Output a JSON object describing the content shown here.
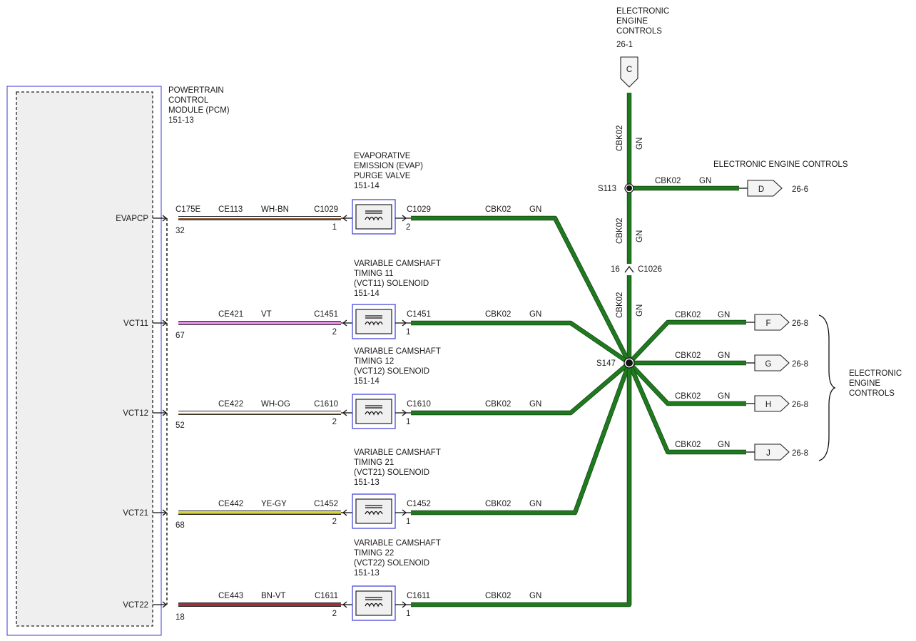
{
  "pcm": {
    "title_lines": [
      "POWERTRAIN",
      "CONTROL",
      "MODULE (PCM)",
      "151-13"
    ],
    "connector": "C175E"
  },
  "circuits": [
    {
      "pin_label": "EVAPCP",
      "pin": "32",
      "circuit": "CE113",
      "color": "WH-BN",
      "conn_in": "C1029",
      "conn_in_pin": "1",
      "conn_out": "C1029",
      "conn_out_pin": "2",
      "out_circuit": "CBK02",
      "out_color": "GN",
      "device_lines": [
        "EVAPORATIVE",
        "EMISSION (EVAP)",
        "PURGE VALVE",
        "151-14"
      ],
      "wire_colors": [
        "#ffffff",
        "#8a5a3a"
      ]
    },
    {
      "pin_label": "VCT11",
      "pin": "67",
      "circuit": "CE421",
      "color": "VT",
      "conn_in": "C1451",
      "conn_in_pin": "2",
      "conn_out": "C1451",
      "conn_out_pin": "1",
      "out_circuit": "CBK02",
      "out_color": "GN",
      "device_lines": [
        "VARIABLE CAMSHAFT",
        "TIMING 11",
        "(VCT11) SOLENOID",
        "151-14"
      ],
      "wire_colors": [
        "#e58de5",
        "#e58de5"
      ]
    },
    {
      "pin_label": "VCT12",
      "pin": "52",
      "circuit": "CE422",
      "color": "WH-OG",
      "conn_in": "C1610",
      "conn_in_pin": "2",
      "conn_out": "C1610",
      "conn_out_pin": "1",
      "out_circuit": "CBK02",
      "out_color": "GN",
      "device_lines": [
        "VARIABLE CAMSHAFT",
        "TIMING 12",
        "(VCT12) SOLENOID",
        "151-14"
      ],
      "wire_colors": [
        "#ffffff",
        "#f0b040"
      ]
    },
    {
      "pin_label": "VCT21",
      "pin": "68",
      "circuit": "CE442",
      "color": "YE-GY",
      "conn_in": "C1452",
      "conn_in_pin": "2",
      "conn_out": "C1452",
      "conn_out_pin": "1",
      "out_circuit": "CBK02",
      "out_color": "GN",
      "device_lines": [
        "VARIABLE CAMSHAFT",
        "TIMING 21",
        "(VCT21) SOLENOID",
        "151-13"
      ],
      "wire_colors": [
        "#f2ea1a",
        "#9a9a9a"
      ]
    },
    {
      "pin_label": "VCT22",
      "pin": "18",
      "circuit": "CE443",
      "color": "BN-VT",
      "conn_in": "C1611",
      "conn_in_pin": "2",
      "conn_out": "C1611",
      "conn_out_pin": "1",
      "out_circuit": "CBK02",
      "out_color": "GN",
      "device_lines": [
        "VARIABLE CAMSHAFT",
        "TIMING 22",
        "(VCT22) SOLENOID",
        "151-13"
      ],
      "wire_colors": [
        "#a0303a",
        "#a0303a"
      ]
    }
  ],
  "top_ref": {
    "title_lines": [
      "ELECTRONIC",
      "ENGINE",
      "CONTROLS"
    ],
    "page": "26-1",
    "letter": "C",
    "circuit": "CBK02",
    "color": "GN"
  },
  "splice_s113": {
    "name": "S113",
    "branch_circuit": "CBK02",
    "branch_color": "GN",
    "branch_title": "ELECTRONIC ENGINE CONTROLS",
    "branch_letter": "D",
    "branch_page": "26-6",
    "down_circuit": "CBK02",
    "down_color": "GN"
  },
  "inline_connector": {
    "pin": "16",
    "name": "C1026"
  },
  "splice_s147": {
    "name": "S147",
    "up_circuit": "CBK02",
    "up_color": "GN",
    "branches": [
      {
        "circuit": "CBK02",
        "color": "GN",
        "letter": "F",
        "page": "26-8"
      },
      {
        "circuit": "CBK02",
        "color": "GN",
        "letter": "G",
        "page": "26-8"
      },
      {
        "circuit": "CBK02",
        "color": "GN",
        "letter": "H",
        "page": "26-8"
      },
      {
        "circuit": "CBK02",
        "color": "GN",
        "letter": "J",
        "page": "26-8"
      }
    ],
    "group_title_lines": [
      "ELECTRONIC",
      "ENGINE",
      "CONTROLS"
    ]
  },
  "colors": {
    "ground_wire": "#1f7a1f",
    "module_border": "#3a3ad6"
  }
}
